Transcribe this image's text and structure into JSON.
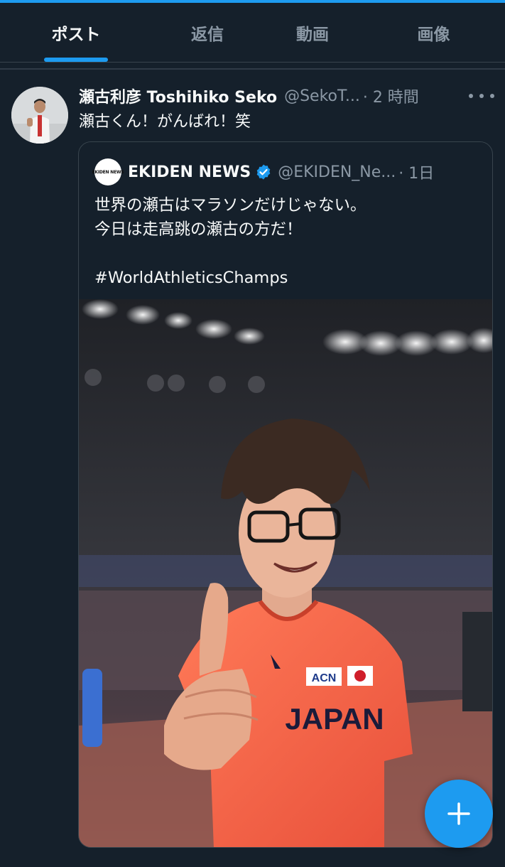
{
  "tabs": [
    {
      "label": "ポスト",
      "active": true
    },
    {
      "label": "返信",
      "active": false
    },
    {
      "label": "動画",
      "active": false
    },
    {
      "label": "画像",
      "active": false
    }
  ],
  "post": {
    "author_name": "瀬古利彦 Toshihiko Seko",
    "handle": "@SekoT...",
    "time": "· 2 時間",
    "text": "瀬古くん！がんばれ！笑",
    "avatar_icon": "avatar-photo",
    "more_icon": "ellipsis-icon"
  },
  "quote": {
    "avatar_label": "EKIDEN NEWS",
    "author_name": "EKIDEN NEWS",
    "verified_icon": "verified-badge-icon",
    "handle": "@EKIDEN_Ne...",
    "time": "· 1日",
    "body_lines": [
      "世界の瀬古はマラソンだけじゃない。",
      "今日は走高跳の瀬古の方だ！",
      "",
      "#WorldAthleticsChamps"
    ],
    "photo": {
      "shirt_text": "JAPAN",
      "sponsor_text": "ACN"
    }
  },
  "fab": {
    "icon": "plus-icon"
  },
  "colors": {
    "background": "#15202b",
    "accent": "#1d9bf0",
    "secondary_text": "#8b98a5",
    "border": "#38444d"
  }
}
